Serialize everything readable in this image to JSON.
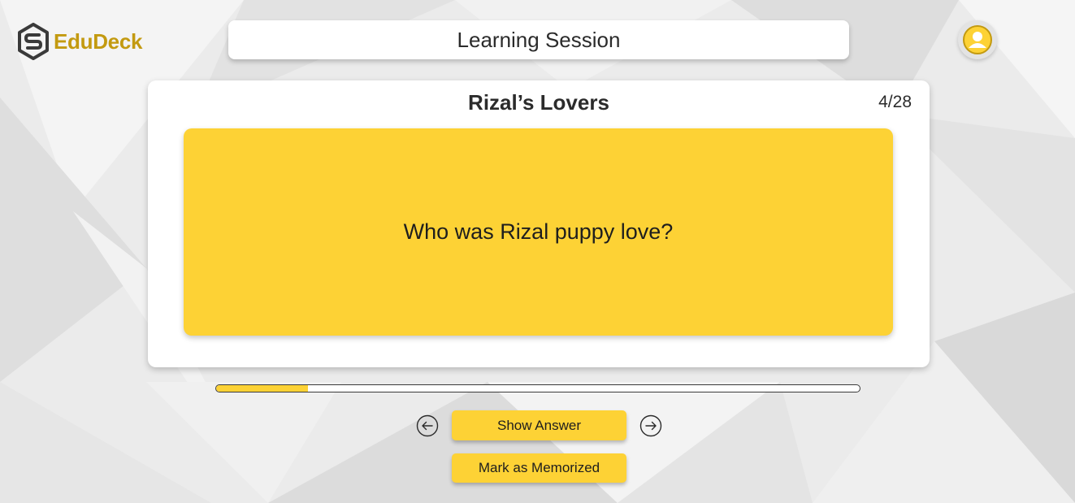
{
  "brand": {
    "name": "EduDeck",
    "color": "#c39a10",
    "logo_icon": "hexagon-s-logo-icon"
  },
  "header": {
    "title": "Learning Session"
  },
  "profile": {
    "icon": "user-avatar-icon"
  },
  "deck": {
    "title": "Rizal’s Lovers",
    "counter": "4/28",
    "progress_fraction": 0.1429
  },
  "flashcard": {
    "question": "Who was Rizal puppy love?"
  },
  "controls": {
    "prev_icon": "arrow-left-circle-icon",
    "next_icon": "arrow-right-circle-icon",
    "show_answer_label": "Show Answer",
    "mark_memorized_label": "Mark as Memorized"
  },
  "colors": {
    "accent": "#fdd235",
    "brand_gold": "#c39a10",
    "card_bg": "#ffffff",
    "text": "#2b2b2b"
  }
}
